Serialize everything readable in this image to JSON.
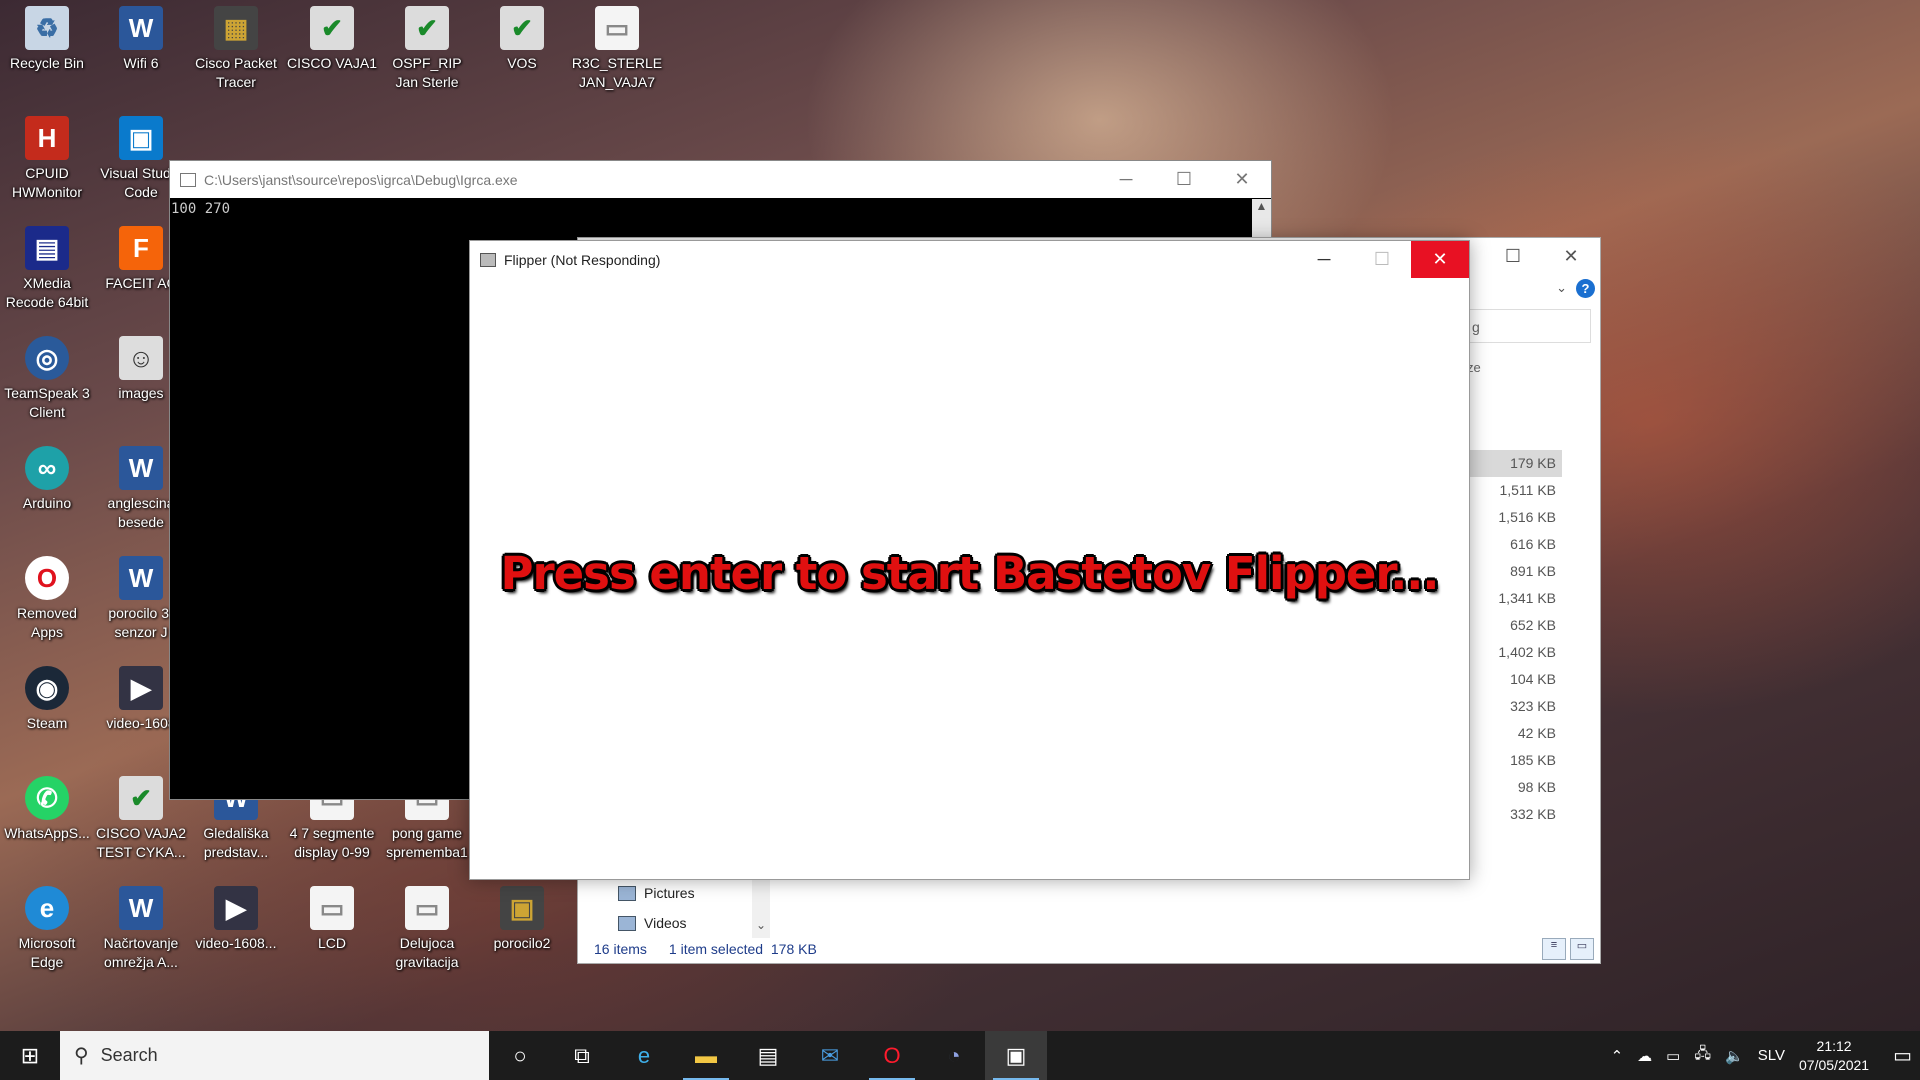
{
  "desktop": {
    "icons": [
      {
        "label": "Recycle Bin",
        "glyph": "♻"
      },
      {
        "label": "Wifi 6",
        "glyph": "W"
      },
      {
        "label": "Cisco Packet Tracer",
        "glyph": "▦"
      },
      {
        "label": "CISCO VAJA1",
        "glyph": "✔"
      },
      {
        "label": "OSPF_RIP Jan Sterle",
        "glyph": "✔"
      },
      {
        "label": "VOS",
        "glyph": "✔"
      },
      {
        "label": "R3C_STERLE JAN_VAJA7",
        "glyph": "▭"
      },
      {
        "label": "CPUID HWMonitor",
        "glyph": "H"
      },
      {
        "label": "Visual Studio Code",
        "glyph": "▣"
      },
      {
        "label": "XMedia Recode 64bit",
        "glyph": "▤"
      },
      {
        "label": "FACEIT AC",
        "glyph": "F"
      },
      {
        "label": "TeamSpeak 3 Client",
        "glyph": "◎"
      },
      {
        "label": "images",
        "glyph": "☺"
      },
      {
        "label": "Arduino",
        "glyph": "∞"
      },
      {
        "label": "anglescina besede",
        "glyph": "W"
      },
      {
        "label": "Removed Apps",
        "glyph": "O"
      },
      {
        "label": "porocilo 3-senzor J",
        "glyph": "W"
      },
      {
        "label": "Steam",
        "glyph": "◉"
      },
      {
        "label": "video-1608",
        "glyph": "▶"
      },
      {
        "label": "WhatsAppS...",
        "glyph": "✆"
      },
      {
        "label": "CISCO VAJA2 TEST CYKA...",
        "glyph": "✔"
      },
      {
        "label": "Gledališka predstav...",
        "glyph": "W"
      },
      {
        "label": "4 7 segmente display 0-99",
        "glyph": "▭"
      },
      {
        "label": "pong game sprememba1",
        "glyph": "▭"
      },
      {
        "label": "Microsoft Edge",
        "glyph": "e"
      },
      {
        "label": "Načrtovanje omrežja A...",
        "glyph": "W"
      },
      {
        "label": "video-1608...",
        "glyph": "▶"
      },
      {
        "label": "LCD",
        "glyph": "▭"
      },
      {
        "label": "Delujoca gravitacija",
        "glyph": "▭"
      },
      {
        "label": "porocilo2",
        "glyph": "▣"
      }
    ]
  },
  "console": {
    "title": "C:\\Users\\janst\\source\\repos\\igrca\\Debug\\Igrca.exe",
    "output": "100 270",
    "minimize": "─",
    "maximize": "☐",
    "close": "✕",
    "scroll_up": "▲"
  },
  "explorer": {
    "minimize": "☐",
    "close": "✕",
    "help": "?",
    "expand": "⌄",
    "search_fragment": "g",
    "size_header_fragment": "ze",
    "sizes": [
      "179 KB",
      "1,511 KB",
      "1,516 KB",
      "616 KB",
      "891 KB",
      "1,341 KB",
      "652 KB",
      "1,402 KB",
      "104 KB",
      "323 KB",
      "42 KB",
      "185 KB",
      "98 KB",
      "332 KB"
    ],
    "nav": [
      {
        "label": "Pictures"
      },
      {
        "label": "Videos"
      }
    ],
    "nav_scroll": "⌄",
    "status": {
      "items": "16 items",
      "selected": "1 item selected",
      "size": "178 KB"
    }
  },
  "flipper": {
    "title": "Flipper (Not Responding)",
    "minimize": "─",
    "maximize": "☐",
    "close": "✕",
    "message": "Press enter to start Bastetov Flipper..."
  },
  "taskbar": {
    "start_glyph": "⊞",
    "search_icon": "⚲",
    "search_placeholder": "Search",
    "apps": [
      {
        "name": "cortana",
        "glyph": "○"
      },
      {
        "name": "task-view",
        "glyph": "⧉"
      },
      {
        "name": "edge",
        "glyph": "e"
      },
      {
        "name": "file-explorer",
        "glyph": "▬"
      },
      {
        "name": "store",
        "glyph": "▤"
      },
      {
        "name": "mail",
        "glyph": "✉"
      },
      {
        "name": "opera",
        "glyph": "O"
      },
      {
        "name": "discord",
        "glyph": "◔"
      },
      {
        "name": "flipper",
        "glyph": "▣"
      }
    ],
    "tray": {
      "chevron": "⌃",
      "cloud": "☁",
      "battery": "▭",
      "network": "🖧",
      "volume": "🔈",
      "language": "SLV",
      "time": "21:12",
      "date": "07/05/2021",
      "notifications": "▭"
    },
    "colors": {
      "accent": "#76b9ed",
      "close_red": "#e81123"
    }
  }
}
